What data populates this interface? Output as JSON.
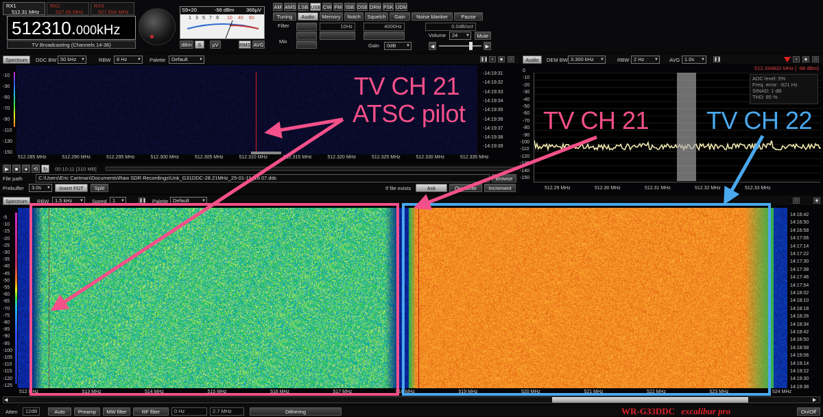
{
  "receiver": {
    "tabs": [
      {
        "label": "RX1",
        "freq": "512.31 MHz"
      },
      {
        "label": "RX2",
        "freq": "527.65 MHz"
      },
      {
        "label": "RX3",
        "freq": "527.654 MHz"
      }
    ],
    "frequency_main": "512310.",
    "frequency_fine": "000",
    "frequency_unit": "kHz",
    "preset_name": "TV Broadcasting (Channels 14-36)"
  },
  "meter": {
    "s_level": "S9+20",
    "dbm": "-56 dBm",
    "uv": "366μV",
    "scale": [
      "1",
      "3",
      "5",
      "7",
      "9",
      "10",
      "40",
      "60"
    ],
    "mode_buttons": [
      "dBm",
      "S",
      "μV"
    ],
    "avg_buttons": [
      "RMS",
      "AVG"
    ]
  },
  "modes": [
    "AM",
    "AMS",
    "LSB",
    "USB",
    "CW",
    "FM",
    "ISB",
    "DSB",
    "DRM",
    "FSK",
    "UDM"
  ],
  "active_mode": "USB",
  "func_tabs": [
    "Tuning",
    "Audio",
    "Memory",
    "Notch",
    "Squelch",
    "Gain",
    "Noise blanker",
    "Pause"
  ],
  "audio": {
    "filter_label": "Filter",
    "filter_value": "10Hz",
    "filter_value2": "4000Hz",
    "mix_label": "Mix",
    "slope_value": "0.0dB/oct",
    "gain_label": "Gain",
    "gain_value": "0dB",
    "volume_label": "Volume",
    "volume_value": "24",
    "mute_label": "Mute"
  },
  "upper_spectrum": {
    "tab": "Spectrum",
    "ddc_bw_label": "DDC BW",
    "ddc_bw_value": "50 kHz",
    "rbw_label": "RBW",
    "rbw_value": "8 Hz",
    "palette_label": "Palette",
    "palette_value": "Default",
    "y_ticks": [
      "-10",
      "-30",
      "-50",
      "-70",
      "-90",
      "-110",
      "-130",
      "-150"
    ],
    "x_ticks": [
      "512.285 MHz",
      "512.290 MHz",
      "512.295 MHz",
      "512.300 MHz",
      "512.305 MHz",
      "512.310 MHz",
      "512.315 MHz",
      "512.320 MHz",
      "512.325 MHz",
      "512.330 MHz",
      "512.335 MHz"
    ],
    "times": [
      "-14:19:31",
      "-14:19:32",
      "-14:19:33",
      "-14:19:34",
      "-14:19:35",
      "-14:19:36",
      "-14:19:37",
      "-14:19:38",
      "-14:19:39"
    ]
  },
  "demod_panel": {
    "tab": "Audio",
    "dem_bw_label": "DEM BW",
    "dem_bw_value": "3.300 kHz",
    "rbw_label": "RBW",
    "rbw_value": "2 Hz",
    "avg_label": "AVG",
    "avg_value": "1.0s",
    "readout": "512.334832 MHz [ -98 dBm]",
    "stats": [
      "ADC level: 5%",
      "Freq. error: -621 Hz",
      "SINAD: 1 dB",
      "THD: 85 %"
    ],
    "y_ticks": [
      "0",
      "-10",
      "-20",
      "-30",
      "-40",
      "-50",
      "-60",
      "-70",
      "-80",
      "-90",
      "-100",
      "-110",
      "-120",
      "-130",
      "-140",
      "-150"
    ],
    "x_ticks": [
      "512.29 MHz",
      "512.30 MHz",
      "512.31 MHz",
      "512.32 MHz",
      "512.33 MHz"
    ]
  },
  "player": {
    "time": "00:10:11 [310 MB]",
    "file_path_label": "File path",
    "file_path": "C:\\Users\\Eric Cartman\\Documents\\Raw SDR Recordings\\Unk_G31DDC-28.21MHz_25-01-11_18 07.ddc",
    "browse": "Browse",
    "prebuffer_label": "Prebuffer",
    "prebuffer_value": "3.0s",
    "insert_fdt": "Insert FDT",
    "split": "Split",
    "if_exists_label": "If file exists",
    "ask": "Ask",
    "overwrite": "Overwrite",
    "increment": "Increment"
  },
  "lower_spectrum": {
    "tab": "Spectrum",
    "rbw_label": "RBW",
    "rbw_value": "1.5 kHz",
    "speed_label": "Speed",
    "speed_value": "1",
    "palette_label": "Palette",
    "palette_value": "Default",
    "y_ticks": [
      "-5",
      "-10",
      "-15",
      "-20",
      "-25",
      "-30",
      "-35",
      "-40",
      "-45",
      "-50",
      "-55",
      "-60",
      "-65",
      "-70",
      "-75",
      "-80",
      "-85",
      "-90",
      "-95",
      "-100",
      "-105",
      "-110",
      "-115",
      "-120",
      "-125"
    ],
    "x_ticks": [
      "512 MHz",
      "513 MHz",
      "514 MHz",
      "515 MHz",
      "516 MHz",
      "517 MHz",
      "518 MHz",
      "519 MHz",
      "520 MHz",
      "521 MHz",
      "522 MHz",
      "523 MHz",
      "524 MHz"
    ],
    "times": [
      "14:16:42",
      "14:16:50",
      "14:16:58",
      "14:17:06",
      "14:17:14",
      "14:17:22",
      "14:17:30",
      "14:17:38",
      "14:17:46",
      "14:17:54",
      "14:18:02",
      "14:18:10",
      "14:18:18",
      "14:18:26",
      "14:18:34",
      "14:18:42",
      "14:18:50",
      "14:18:58",
      "14:19:06",
      "14:19:14",
      "14:19:22",
      "14:19:30",
      "14:19:38"
    ]
  },
  "bottom_bar": {
    "atten_label": "Atten",
    "atten_value": "12dB",
    "auto": "Auto",
    "preamp": "Preamp",
    "mw_filter": "MW filter",
    "rf_filter": "RF filter",
    "rf_value1": "0 Hz",
    "rf_value2": "2.7 MHz",
    "dithering": "Dithering",
    "brand": "WR-G33DDC",
    "brand_sub": "excalibur pro",
    "onoff": "On/Off"
  },
  "annotations": {
    "pilot_line1": "TV CH 21",
    "pilot_line2": "ATSC pilot",
    "ch21": "TV CH 21",
    "ch22": "TV CH 22"
  },
  "colors": {
    "pink": "#f4508a",
    "blue": "#4aa8ee",
    "brand_red": "#e0202a",
    "trace": "#f2eab0"
  }
}
